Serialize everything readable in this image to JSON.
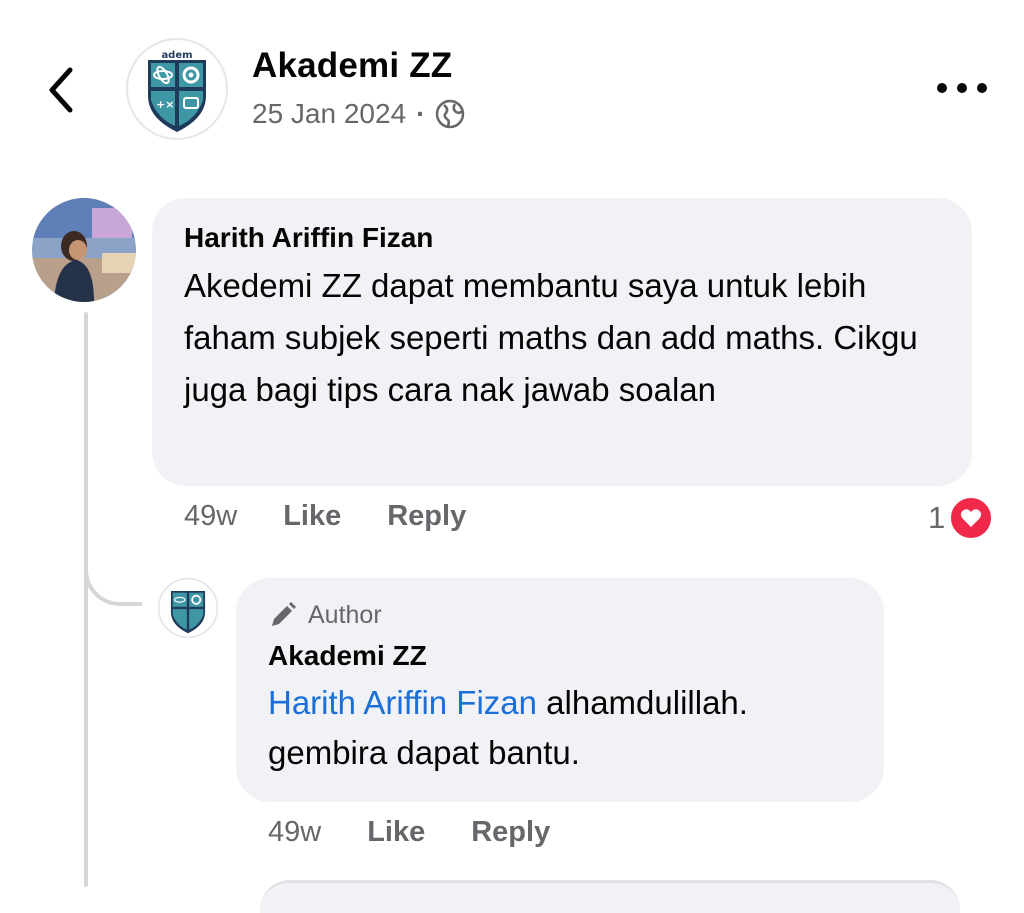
{
  "header": {
    "page_name": "Akademi ZZ",
    "date": "25 Jan 2024",
    "separator": "·",
    "logo_text": "adem"
  },
  "comment": {
    "author": "Harith Ariffin Fizan",
    "text": "Akedemi ZZ dapat membantu saya untuk lebih faham subjek seperti maths dan add maths. Cikgu juga bagi tips cara nak jawab soalan",
    "time": "49w",
    "like_label": "Like",
    "reply_label": "Reply",
    "reaction_count": "1"
  },
  "reply": {
    "badge": "Author",
    "author": "Akademi ZZ",
    "mention": "Harith Ariffin Fizan",
    "text": " alhamdulillah. gembira dapat bantu.",
    "time": "49w",
    "like_label": "Like",
    "reply_label": "Reply"
  },
  "colors": {
    "logo_teal": "#3f97a6",
    "logo_navy": "#1f3b5c",
    "mention": "#1b6fd8",
    "heart": "#f02849"
  }
}
